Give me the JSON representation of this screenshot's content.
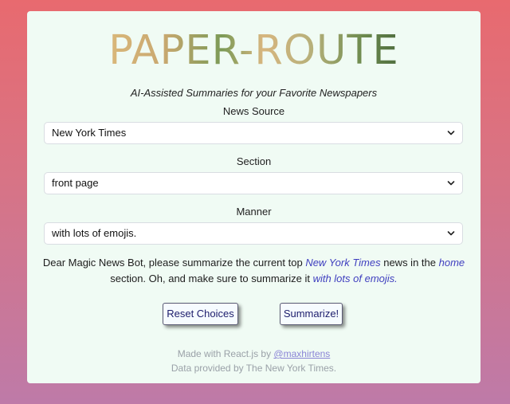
{
  "app": {
    "logo": "PAPER-ROUTE",
    "tagline": "AI-Assisted Summaries for your Favorite Newspapers"
  },
  "form": {
    "source": {
      "label": "News Source",
      "value": "New York Times",
      "icon": "chevron-down-icon"
    },
    "section": {
      "label": "Section",
      "value": "front page",
      "icon": "chevron-down-icon"
    },
    "manner": {
      "label": "Manner",
      "value": "with lots of emojis.",
      "icon": "chevron-down-icon"
    }
  },
  "message": {
    "part1": "Dear Magic News Bot, please summarize the current top ",
    "source": "New York Times",
    "part2": " news in the ",
    "section": "home",
    "part3": " section. Oh, and make sure to summarize it ",
    "manner": "with lots of emojis."
  },
  "buttons": {
    "reset": "Reset Choices",
    "summarize": "Summarize!"
  },
  "footer": {
    "made_with": "Made with React.js by ",
    "author_link": "@maxhirtens",
    "data_credit": "Data provided by The New York Times."
  },
  "colors": {
    "background_top": "#e86a6f",
    "background_bottom": "#be7aa8",
    "card": "#f0fbf4",
    "highlight": "#3f3fbf",
    "button_text": "#1c1c6b"
  }
}
